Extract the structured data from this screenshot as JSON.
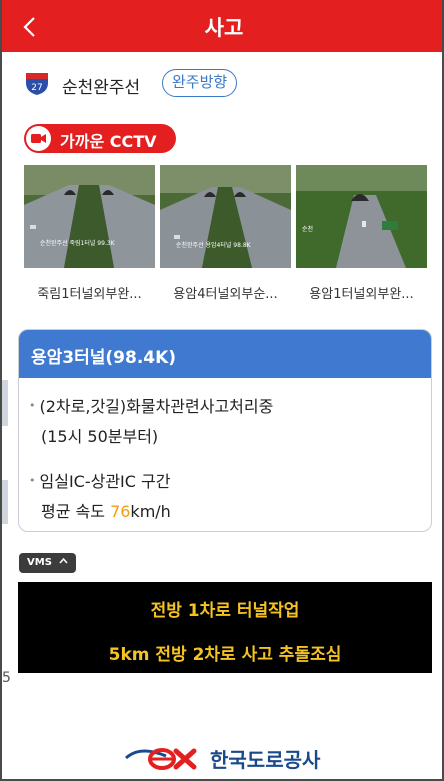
{
  "header": {
    "title": "사고"
  },
  "route": {
    "name": "순천완주선",
    "number": "27",
    "direction": "완주방향"
  },
  "cctv": {
    "label": "가까운 CCTV"
  },
  "cameras": [
    {
      "label": "죽림1터널외부완...",
      "overlay": "순천완주선   죽림1터널   99.3K"
    },
    {
      "label": "용암4터널외부순...",
      "overlay": "순천완주선   용암4터널   98.8K"
    },
    {
      "label": "용암1터널외부완...",
      "overlay": "순천"
    }
  ],
  "incident": {
    "title": "용암3터널(98.4K)",
    "desc_line1": "(2차로,갓길)화물차관련사고처리중",
    "desc_line2": "(15시 50분부터)",
    "section_line": "임실IC-상관IC 구간",
    "speed_prefix": "평균 속도 ",
    "speed_value": "76",
    "speed_unit": "km/h"
  },
  "vms": {
    "tag": "VMS",
    "line1": "전방 1차로 터널작업",
    "line2": "5km 전방 2차로 사고 추돌조심"
  },
  "footer": {
    "logo_text": "한국도로공사"
  },
  "edge": {
    "char": "5"
  },
  "colors": {
    "header": "#e41f1f",
    "card_head": "#3f7ad0",
    "vms_text": "#f6c324",
    "speed": "#f39c12",
    "pill": "#3b79c7"
  },
  "icons": {
    "back": "chevron-left-icon",
    "route": "highway-shield-icon",
    "cctv": "video-camera-icon",
    "vms_toggle": "chevron-up-icon"
  }
}
